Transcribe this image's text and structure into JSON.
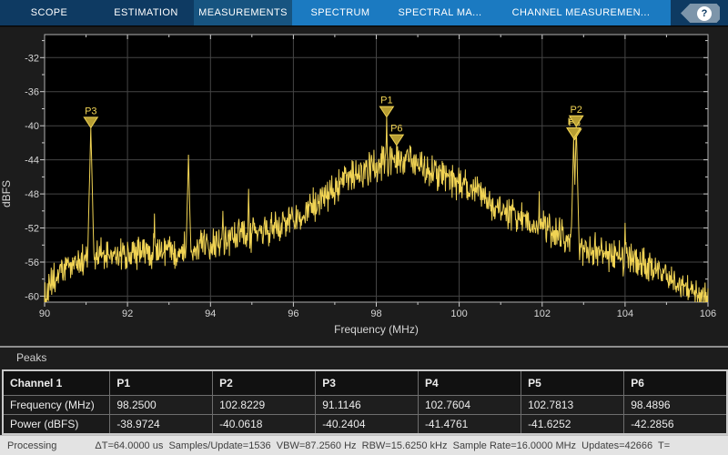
{
  "tabbar": {
    "tabs": [
      {
        "label": "SCOPE",
        "group": "main"
      },
      {
        "label": "ESTIMATION",
        "group": "main"
      },
      {
        "label": "MEASUREMENTS",
        "group": "main",
        "selected": true
      },
      {
        "label": "SPECTRUM",
        "group": "contextual"
      },
      {
        "label": "SPECTRAL MA...",
        "group": "contextual"
      },
      {
        "label": "CHANNEL MEASUREMEN...",
        "group": "contextual"
      }
    ],
    "help_icon": "?"
  },
  "colors": {
    "toolstrip_navy": "#0e3a62",
    "toolstrip_selected": "#175480",
    "toolstrip_contextual": "#1b7ac1",
    "trace_yellow": "#f0d354",
    "marker_fill": "#b79e33",
    "grid": "#454545",
    "axes_box": "#b0b0b0",
    "tick_label": "#d6d6d6",
    "status_bg": "#e3e3e3"
  },
  "chart_data": {
    "type": "line",
    "title": "",
    "xlabel": "Frequency (MHz)",
    "ylabel": "dBFS",
    "xlim": [
      90,
      106
    ],
    "ylim": [
      -60.7,
      -29.3
    ],
    "xticks": [
      90,
      92,
      94,
      96,
      98,
      100,
      102,
      104,
      106
    ],
    "yticks": [
      -32,
      -36,
      -40,
      -44,
      -48,
      -52,
      -56,
      -60
    ],
    "x_minor_step": 1,
    "y_minor_step": 2,
    "grid": true,
    "legend": "none",
    "noise_floor_envelope": [
      [
        90.0,
        -60.6
      ],
      [
        90.15,
        -58.8
      ],
      [
        90.35,
        -57.4
      ],
      [
        90.7,
        -56.1
      ],
      [
        91.0,
        -55.6
      ],
      [
        91.5,
        -55.3
      ],
      [
        92.0,
        -55.0
      ],
      [
        92.5,
        -54.8
      ],
      [
        93.0,
        -54.6
      ],
      [
        93.6,
        -54.1
      ],
      [
        94.0,
        -53.6
      ],
      [
        94.5,
        -53.1
      ],
      [
        95.0,
        -52.8
      ],
      [
        95.5,
        -52.1
      ],
      [
        96.0,
        -50.9
      ],
      [
        96.5,
        -49.4
      ],
      [
        97.0,
        -47.6
      ],
      [
        97.4,
        -46.1
      ],
      [
        97.8,
        -45.0
      ],
      [
        98.1,
        -44.4
      ],
      [
        98.35,
        -43.9
      ],
      [
        98.6,
        -44.0
      ],
      [
        99.0,
        -44.7
      ],
      [
        99.5,
        -45.7
      ],
      [
        100.0,
        -46.7
      ],
      [
        100.5,
        -48.1
      ],
      [
        101.0,
        -49.9
      ],
      [
        101.5,
        -51.1
      ],
      [
        102.0,
        -51.9
      ],
      [
        102.4,
        -52.7
      ],
      [
        103.0,
        -54.4
      ],
      [
        103.5,
        -55.1
      ],
      [
        104.2,
        -55.9
      ],
      [
        104.7,
        -56.5
      ],
      [
        105.0,
        -57.4
      ],
      [
        105.4,
        -58.7
      ],
      [
        105.8,
        -60.1
      ],
      [
        106.0,
        -60.8
      ]
    ],
    "spikes": [
      {
        "f": 91.1146,
        "db": -40.2404,
        "w": 0.1
      },
      {
        "f": 92.65,
        "db": -50.3,
        "w": 0.07
      },
      {
        "f": 93.47,
        "db": -43.4,
        "w": 0.1
      },
      {
        "f": 94.3,
        "db": -50.0,
        "w": 0.1
      },
      {
        "f": 94.92,
        "db": -47.4,
        "w": 0.08
      },
      {
        "f": 98.25,
        "db": -38.9724,
        "w": 0.07
      },
      {
        "f": 98.4896,
        "db": -42.2856,
        "w": 0.05
      },
      {
        "f": 100.15,
        "db": -46.4,
        "w": 0.05
      },
      {
        "f": 101.2,
        "db": -48.6,
        "w": 0.05
      },
      {
        "f": 101.93,
        "db": -47.7,
        "w": 0.07
      },
      {
        "f": 102.7604,
        "db": -41.4761,
        "w": 0.1
      },
      {
        "f": 102.8229,
        "db": -40.0618,
        "w": 0.1
      },
      {
        "f": 104.0,
        "db": -51.4,
        "w": 0.09
      },
      {
        "f": 105.93,
        "db": -58.4,
        "w": 0.06
      }
    ],
    "noise_amplitude_db": 1.2,
    "markers": [
      {
        "name": "P1",
        "freq": 98.25,
        "power": -38.9724
      },
      {
        "name": "P2",
        "freq": 102.8229,
        "power": -40.0618
      },
      {
        "name": "P3",
        "freq": 91.1146,
        "power": -40.2404
      },
      {
        "name": "P4",
        "freq": 102.7604,
        "power": -41.4761
      },
      {
        "name": "P5",
        "freq": 102.7813,
        "power": -41.6252
      },
      {
        "name": "P6",
        "freq": 98.4896,
        "power": -42.2856
      }
    ]
  },
  "peaks_panel": {
    "title": "Peaks",
    "table": {
      "header": [
        "Channel 1",
        "P1",
        "P2",
        "P3",
        "P4",
        "P5",
        "P6"
      ],
      "rows": [
        {
          "label": "Frequency (MHz)",
          "values": [
            "98.2500",
            "102.8229",
            "91.1146",
            "102.7604",
            "102.7813",
            "98.4896"
          ]
        },
        {
          "label": "Power (dBFS)",
          "values": [
            "-38.9724",
            "-40.0618",
            "-40.2404",
            "-41.4761",
            "-41.6252",
            "-42.2856"
          ]
        }
      ]
    }
  },
  "statusbar": {
    "state": "Processing",
    "details": "ΔT=64.0000 us  Samples/Update=1536  VBW=87.2560 Hz  RBW=15.6250 kHz  Sample Rate=16.0000 MHz  Updates=42666  T="
  }
}
